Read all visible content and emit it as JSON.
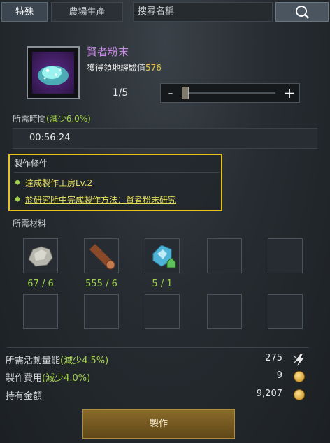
{
  "tabs": {
    "special": "特殊",
    "farm": "農場生產"
  },
  "search": {
    "placeholder": "搜尋名稱"
  },
  "item": {
    "name": "賢者粉末",
    "exp_label": "獲得領地經驗值",
    "exp_value": "576",
    "quantity": "1/5"
  },
  "slider": {
    "minus": "-",
    "plus": "+"
  },
  "time": {
    "label": "所需時間",
    "reduction": "(減少6.0%)",
    "value": "00:56:24"
  },
  "conditions": {
    "title": "製作條件",
    "items": [
      "達成製作工房Lv.2",
      "於研究所中完成製作方法：賢者粉末研究"
    ]
  },
  "materials": {
    "title": "所需材料",
    "items": [
      {
        "icon": "ore-icon",
        "count": "67 / 6"
      },
      {
        "icon": "timber-icon",
        "count": "555 / 6"
      },
      {
        "icon": "crystal-icon",
        "count": "5 / 1"
      }
    ]
  },
  "costs": {
    "energy_label": "所需活動量能",
    "energy_reduction": "(減少4.5%)",
    "energy_value": "275",
    "fee_label": "製作費用",
    "fee_reduction": "(減少4.0%)",
    "fee_value": "9",
    "gold_label": "持有金額",
    "gold_value": "9,207"
  },
  "craft_button": "製作",
  "colors": {
    "accent_green": "#a4d34a",
    "highlight_yellow": "#e6c21e",
    "item_purple": "#c98ae8",
    "gold": "#e5c74c"
  }
}
